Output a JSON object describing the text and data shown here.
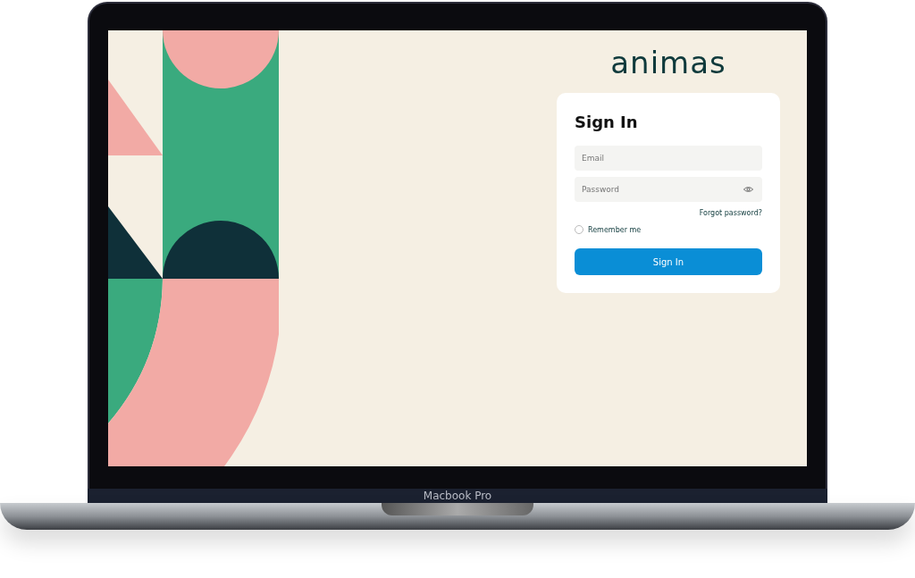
{
  "device": {
    "label": "Macbook Pro"
  },
  "logo": "animas",
  "sign_in": {
    "title": "Sign In",
    "fields": [
      {
        "placeholder": "Email",
        "kind": "text"
      },
      {
        "placeholder": "Password",
        "kind": "password"
      }
    ],
    "forgot_link": "Forgot password?",
    "remember": {
      "label": "Remember me",
      "checked": false
    },
    "button": "Sign In"
  }
}
